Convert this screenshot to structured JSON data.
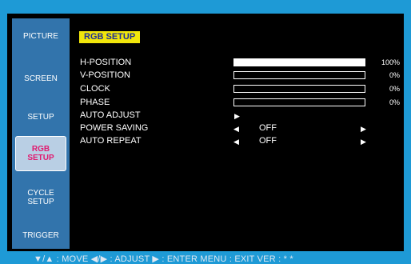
{
  "sidebar": {
    "items": [
      {
        "label": "PICTURE"
      },
      {
        "label": "SCREEN"
      },
      {
        "label": "SETUP"
      },
      {
        "label_line1": "RGB",
        "label_line2": "SETUP",
        "active": true
      },
      {
        "label_line1": "CYCLE",
        "label_line2": "SETUP"
      },
      {
        "label": "TRIGGER"
      }
    ]
  },
  "main": {
    "title": "RGB SETUP",
    "rows": [
      {
        "label": "H-POSITION",
        "percent": "100%",
        "level": 1.0
      },
      {
        "label": "V-POSITION",
        "percent": "0%",
        "level": 0
      },
      {
        "label": "CLOCK",
        "percent": "0%",
        "level": 0
      },
      {
        "label": "PHASE",
        "percent": "0%",
        "level": 0
      },
      {
        "label": "AUTO ADJUST"
      },
      {
        "label": "POWER SAVING",
        "value": "OFF"
      },
      {
        "label": "AUTO REPEAT",
        "value": "OFF"
      }
    ]
  },
  "footer": {
    "hint": "▼/▲ : MOVE    ◀/▶ : ADJUST    ▶ : ENTER    MENU : EXIT    VER : * *"
  },
  "colors": {
    "accent": "#1e9ad6",
    "sidebar": "#3274ac",
    "title_bg": "#f1e60b",
    "title_fg": "#1e2f95",
    "active_label": "#e01b6f"
  }
}
